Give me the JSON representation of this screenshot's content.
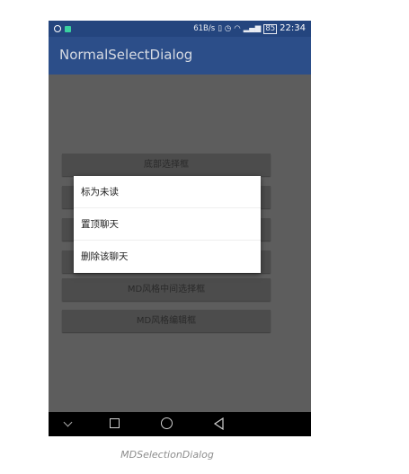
{
  "status_bar": {
    "network_speed": "61B/s",
    "time": "22:34",
    "battery_label": "85",
    "colors": {
      "status_bg": "#24457e",
      "accent_green": "#3ad1a0"
    }
  },
  "app_bar": {
    "title": "NormalSelectDialog",
    "colors": {
      "bg": "#2c4e89"
    }
  },
  "buttons": [
    {
      "label": "底部选择框"
    },
    {
      "label": ""
    },
    {
      "label": ""
    },
    {
      "label": ""
    },
    {
      "label": "MD风格中间选择框"
    },
    {
      "label": "MD风格编辑框"
    }
  ],
  "dialog": {
    "items": [
      {
        "label": "标为未读"
      },
      {
        "label": "置顶聊天"
      },
      {
        "label": "删除该聊天"
      }
    ]
  },
  "nav_bar": {
    "icons": [
      "chevron-down-icon",
      "recent-apps-icon",
      "home-icon",
      "back-icon"
    ]
  },
  "caption": "MDSelectionDialog"
}
